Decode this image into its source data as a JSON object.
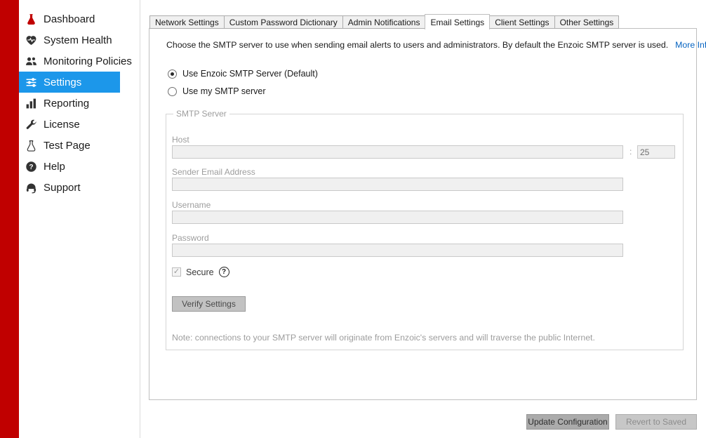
{
  "sidebar": {
    "items": [
      {
        "label": "Dashboard"
      },
      {
        "label": "System Health"
      },
      {
        "label": "Monitoring Policies"
      },
      {
        "label": "Settings",
        "active": true
      },
      {
        "label": "Reporting"
      },
      {
        "label": "License"
      },
      {
        "label": "Test Page"
      },
      {
        "label": "Help"
      },
      {
        "label": "Support"
      }
    ]
  },
  "tabs": {
    "items": [
      {
        "label": "Network Settings"
      },
      {
        "label": "Custom Password Dictionary"
      },
      {
        "label": "Admin Notifications"
      },
      {
        "label": "Email Settings",
        "active": true
      },
      {
        "label": "Client Settings"
      },
      {
        "label": "Other Settings"
      }
    ]
  },
  "email_settings": {
    "description": "Choose the SMTP server to use when sending email alerts to users and administrators. By default the Enzoic SMTP server is used.",
    "more_info_link": "More Info",
    "radio_enzoic": "Use Enzoic SMTP Server (Default)",
    "radio_enzoic_selected": true,
    "radio_custom": "Use my SMTP server",
    "smtp_group": {
      "title": "SMTP Server",
      "host_label": "Host",
      "host_value": "",
      "port_separator": ":",
      "port_value": "25",
      "sender_label": "Sender Email Address",
      "sender_value": "",
      "username_label": "Username",
      "username_value": "",
      "password_label": "Password",
      "password_value": "",
      "secure_label": "Secure",
      "secure_checked": "✓",
      "help_icon_glyph": "?",
      "verify_button": "Verify Settings",
      "note": "Note: connections to your SMTP server will originate from Enzoic's servers and will traverse the public Internet."
    }
  },
  "footer": {
    "update_button": "Update Configuration",
    "revert_button": "Revert to Saved"
  },
  "colors": {
    "accent_red": "#C00000",
    "active_blue": "#1C97EA",
    "link_blue": "#0563C1",
    "disabled_text": "#9D9D9D"
  }
}
